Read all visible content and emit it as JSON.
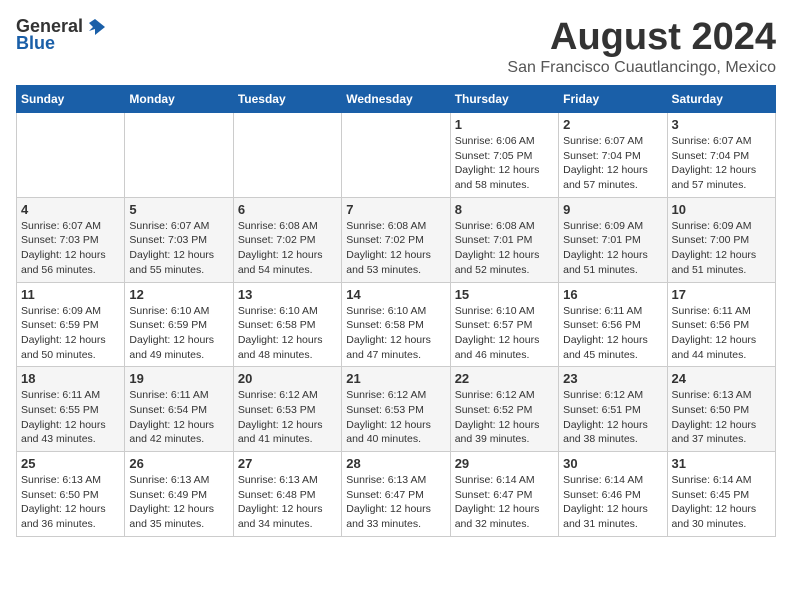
{
  "header": {
    "logo_general": "General",
    "logo_blue": "Blue",
    "title": "August 2024",
    "location": "San Francisco Cuautlancingo, Mexico"
  },
  "days_of_week": [
    "Sunday",
    "Monday",
    "Tuesday",
    "Wednesday",
    "Thursday",
    "Friday",
    "Saturday"
  ],
  "weeks": [
    [
      {
        "day": "",
        "info": ""
      },
      {
        "day": "",
        "info": ""
      },
      {
        "day": "",
        "info": ""
      },
      {
        "day": "",
        "info": ""
      },
      {
        "day": "1",
        "info": "Sunrise: 6:06 AM\nSunset: 7:05 PM\nDaylight: 12 hours\nand 58 minutes."
      },
      {
        "day": "2",
        "info": "Sunrise: 6:07 AM\nSunset: 7:04 PM\nDaylight: 12 hours\nand 57 minutes."
      },
      {
        "day": "3",
        "info": "Sunrise: 6:07 AM\nSunset: 7:04 PM\nDaylight: 12 hours\nand 57 minutes."
      }
    ],
    [
      {
        "day": "4",
        "info": "Sunrise: 6:07 AM\nSunset: 7:03 PM\nDaylight: 12 hours\nand 56 minutes."
      },
      {
        "day": "5",
        "info": "Sunrise: 6:07 AM\nSunset: 7:03 PM\nDaylight: 12 hours\nand 55 minutes."
      },
      {
        "day": "6",
        "info": "Sunrise: 6:08 AM\nSunset: 7:02 PM\nDaylight: 12 hours\nand 54 minutes."
      },
      {
        "day": "7",
        "info": "Sunrise: 6:08 AM\nSunset: 7:02 PM\nDaylight: 12 hours\nand 53 minutes."
      },
      {
        "day": "8",
        "info": "Sunrise: 6:08 AM\nSunset: 7:01 PM\nDaylight: 12 hours\nand 52 minutes."
      },
      {
        "day": "9",
        "info": "Sunrise: 6:09 AM\nSunset: 7:01 PM\nDaylight: 12 hours\nand 51 minutes."
      },
      {
        "day": "10",
        "info": "Sunrise: 6:09 AM\nSunset: 7:00 PM\nDaylight: 12 hours\nand 51 minutes."
      }
    ],
    [
      {
        "day": "11",
        "info": "Sunrise: 6:09 AM\nSunset: 6:59 PM\nDaylight: 12 hours\nand 50 minutes."
      },
      {
        "day": "12",
        "info": "Sunrise: 6:10 AM\nSunset: 6:59 PM\nDaylight: 12 hours\nand 49 minutes."
      },
      {
        "day": "13",
        "info": "Sunrise: 6:10 AM\nSunset: 6:58 PM\nDaylight: 12 hours\nand 48 minutes."
      },
      {
        "day": "14",
        "info": "Sunrise: 6:10 AM\nSunset: 6:58 PM\nDaylight: 12 hours\nand 47 minutes."
      },
      {
        "day": "15",
        "info": "Sunrise: 6:10 AM\nSunset: 6:57 PM\nDaylight: 12 hours\nand 46 minutes."
      },
      {
        "day": "16",
        "info": "Sunrise: 6:11 AM\nSunset: 6:56 PM\nDaylight: 12 hours\nand 45 minutes."
      },
      {
        "day": "17",
        "info": "Sunrise: 6:11 AM\nSunset: 6:56 PM\nDaylight: 12 hours\nand 44 minutes."
      }
    ],
    [
      {
        "day": "18",
        "info": "Sunrise: 6:11 AM\nSunset: 6:55 PM\nDaylight: 12 hours\nand 43 minutes."
      },
      {
        "day": "19",
        "info": "Sunrise: 6:11 AM\nSunset: 6:54 PM\nDaylight: 12 hours\nand 42 minutes."
      },
      {
        "day": "20",
        "info": "Sunrise: 6:12 AM\nSunset: 6:53 PM\nDaylight: 12 hours\nand 41 minutes."
      },
      {
        "day": "21",
        "info": "Sunrise: 6:12 AM\nSunset: 6:53 PM\nDaylight: 12 hours\nand 40 minutes."
      },
      {
        "day": "22",
        "info": "Sunrise: 6:12 AM\nSunset: 6:52 PM\nDaylight: 12 hours\nand 39 minutes."
      },
      {
        "day": "23",
        "info": "Sunrise: 6:12 AM\nSunset: 6:51 PM\nDaylight: 12 hours\nand 38 minutes."
      },
      {
        "day": "24",
        "info": "Sunrise: 6:13 AM\nSunset: 6:50 PM\nDaylight: 12 hours\nand 37 minutes."
      }
    ],
    [
      {
        "day": "25",
        "info": "Sunrise: 6:13 AM\nSunset: 6:50 PM\nDaylight: 12 hours\nand 36 minutes."
      },
      {
        "day": "26",
        "info": "Sunrise: 6:13 AM\nSunset: 6:49 PM\nDaylight: 12 hours\nand 35 minutes."
      },
      {
        "day": "27",
        "info": "Sunrise: 6:13 AM\nSunset: 6:48 PM\nDaylight: 12 hours\nand 34 minutes."
      },
      {
        "day": "28",
        "info": "Sunrise: 6:13 AM\nSunset: 6:47 PM\nDaylight: 12 hours\nand 33 minutes."
      },
      {
        "day": "29",
        "info": "Sunrise: 6:14 AM\nSunset: 6:47 PM\nDaylight: 12 hours\nand 32 minutes."
      },
      {
        "day": "30",
        "info": "Sunrise: 6:14 AM\nSunset: 6:46 PM\nDaylight: 12 hours\nand 31 minutes."
      },
      {
        "day": "31",
        "info": "Sunrise: 6:14 AM\nSunset: 6:45 PM\nDaylight: 12 hours\nand 30 minutes."
      }
    ]
  ]
}
